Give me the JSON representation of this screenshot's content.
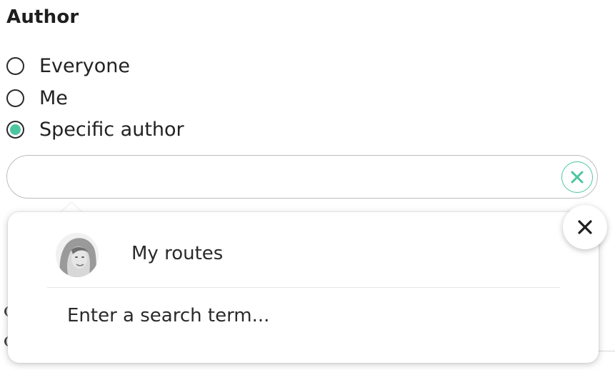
{
  "author_filter": {
    "title": "Author",
    "options": [
      {
        "label": "Everyone",
        "selected": false
      },
      {
        "label": "Me",
        "selected": false
      },
      {
        "label": "Specific author",
        "selected": true
      }
    ]
  },
  "search": {
    "value": "",
    "placeholder": "",
    "clear_icon": "close-icon"
  },
  "dropdown": {
    "suggestion_label": "My routes",
    "hint": "Enter a search term...",
    "close_icon": "close-icon"
  },
  "colors": {
    "accent": "#4cc5a1",
    "text": "#222222",
    "border": "#bdbdbd"
  }
}
